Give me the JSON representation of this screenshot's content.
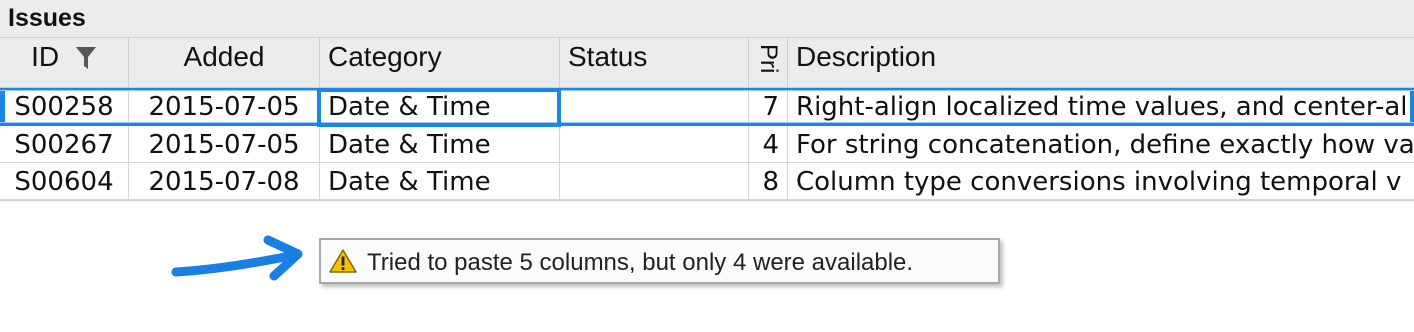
{
  "sheet": {
    "title": "Issues",
    "columns": [
      {
        "key": "id",
        "label": "ID"
      },
      {
        "key": "added",
        "label": "Added"
      },
      {
        "key": "category",
        "label": "Category"
      },
      {
        "key": "status",
        "label": "Status"
      },
      {
        "key": "pri",
        "label": "Pri"
      },
      {
        "key": "description",
        "label": "Description"
      }
    ],
    "rows": [
      {
        "id": "S00258",
        "added": "2015-07-05",
        "category": "Date & Time",
        "status": "",
        "pri": "7",
        "description": "Right-align localized time values, and center-al"
      },
      {
        "id": "S00267",
        "added": "2015-07-05",
        "category": "Date & Time",
        "status": "",
        "pri": "4",
        "description": "For string concatenation, define exactly how va"
      },
      {
        "id": "S00604",
        "added": "2015-07-08",
        "category": "Date & Time",
        "status": "",
        "pri": "8",
        "description": "Column type conversions involving temporal v"
      }
    ]
  },
  "toast": {
    "message": "Tried to paste 5 columns, but only 4 were available.",
    "icon": "warning-icon"
  },
  "colors": {
    "selection": "#1a86e6",
    "arrow": "#1a7fe3",
    "header_bg": "#ececec",
    "warning": "#f2c200"
  }
}
